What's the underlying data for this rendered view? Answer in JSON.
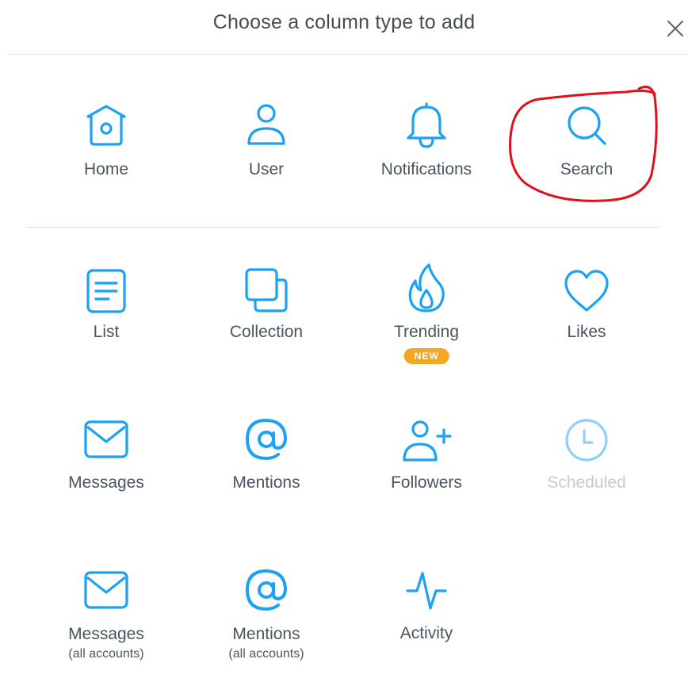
{
  "dialog": {
    "title": "Choose a column type to add"
  },
  "colors": {
    "icon_blue": "#1da1f2",
    "text": "#4a5560",
    "disabled": "#c5cdd4",
    "badge": "#f5a623",
    "annotation": "#e0101a"
  },
  "columns": {
    "home": {
      "label": "Home",
      "icon": "home-icon"
    },
    "user": {
      "label": "User",
      "icon": "user-icon"
    },
    "notifications": {
      "label": "Notifications",
      "icon": "bell-icon"
    },
    "search": {
      "label": "Search",
      "icon": "search-icon"
    },
    "list": {
      "label": "List",
      "icon": "list-icon"
    },
    "collection": {
      "label": "Collection",
      "icon": "collection-icon"
    },
    "trending": {
      "label": "Trending",
      "badge": "NEW",
      "icon": "flame-icon"
    },
    "likes": {
      "label": "Likes",
      "icon": "heart-icon"
    },
    "messages": {
      "label": "Messages",
      "icon": "envelope-icon"
    },
    "mentions": {
      "label": "Mentions",
      "icon": "at-icon"
    },
    "followers": {
      "label": "Followers",
      "icon": "user-plus-icon"
    },
    "scheduled": {
      "label": "Scheduled",
      "icon": "clock-icon",
      "disabled": true
    },
    "messages_all": {
      "label": "Messages",
      "sublabel": "(all accounts)",
      "icon": "envelope-icon"
    },
    "mentions_all": {
      "label": "Mentions",
      "sublabel": "(all accounts)",
      "icon": "at-icon"
    },
    "activity": {
      "label": "Activity",
      "icon": "activity-icon"
    }
  }
}
